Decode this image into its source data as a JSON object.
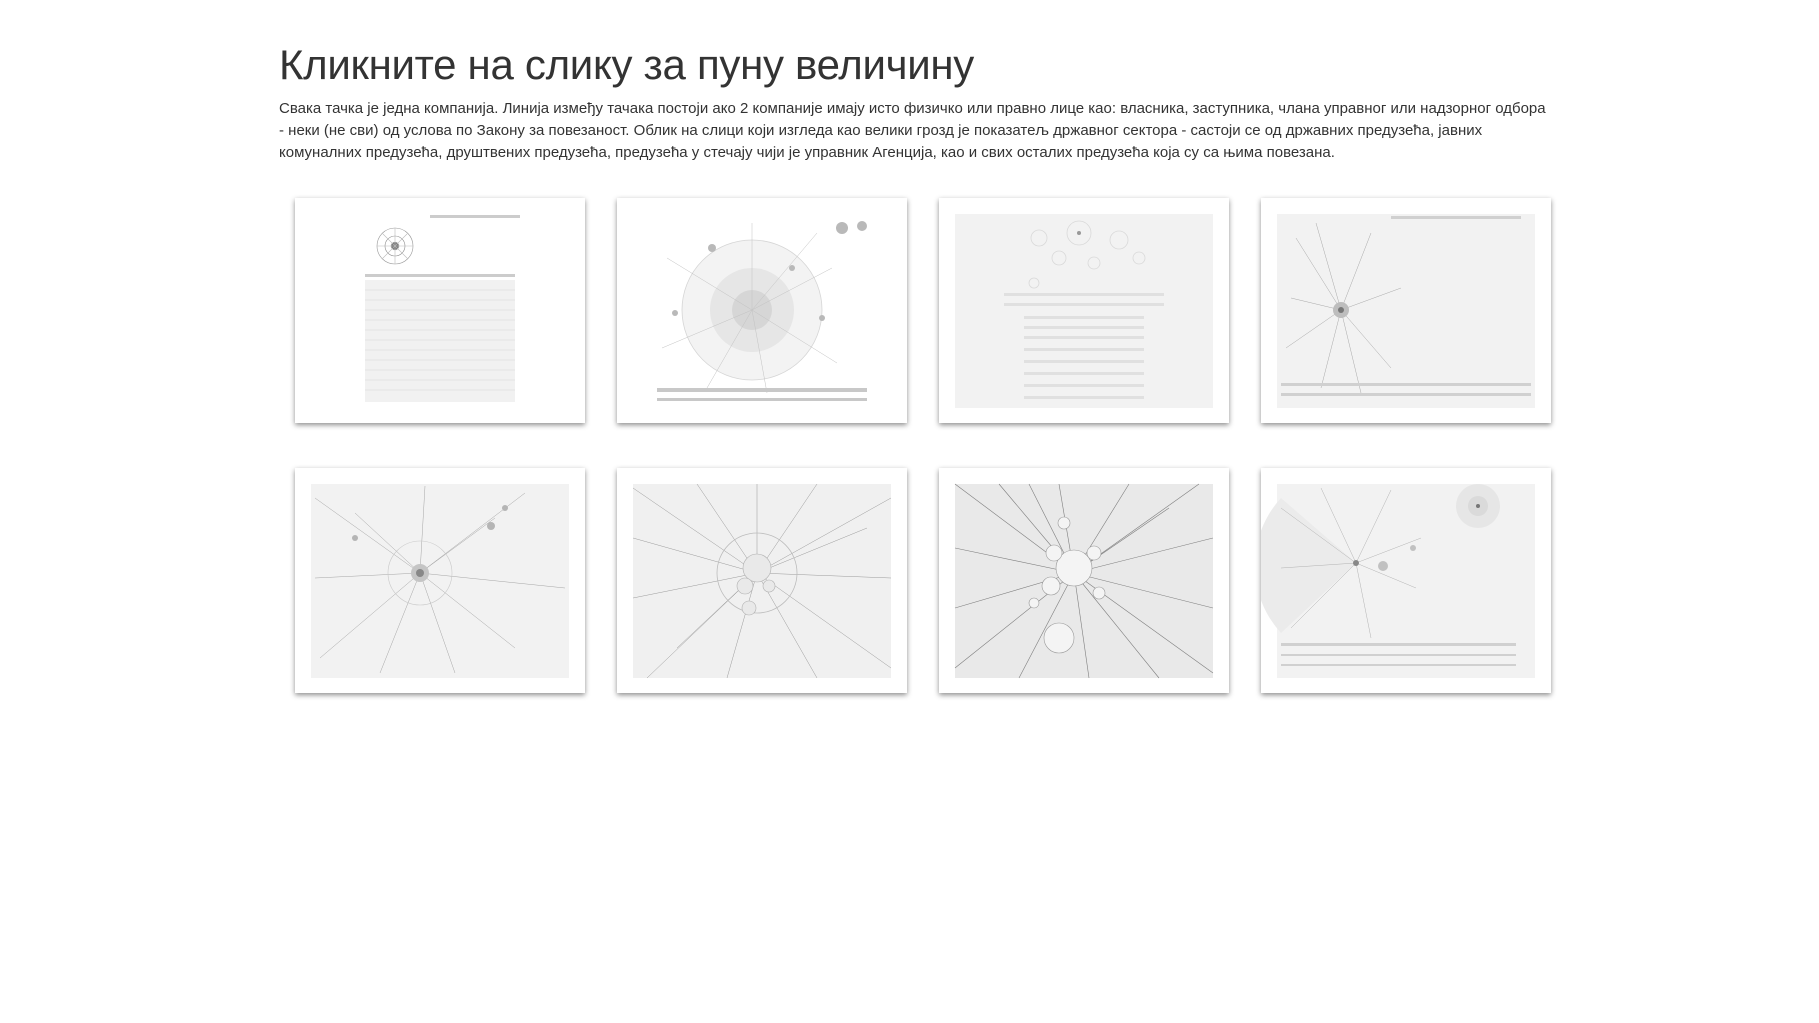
{
  "page": {
    "title": "Кликните на слику за пуну величину",
    "intro": "Свака тачка је једна компанија. Линија између тачака постоји ако 2 компаније имају исто физичко или правно лице као: власника, заступника, члана управног или надзорног одбора - неки (не сви) од услова по Закону за повезаност. Облик на слици који изгледа као велики грозд је показатељ државног сектора - састоји се од државних предузећа, јавних комуналних предузећа, друштвених предузећа, предузећа у стечају чији је управник Агенција, као и свих осталих предузећа која су са њима повезана."
  },
  "gallery": {
    "thumbnails": [
      {
        "icon": "network-graph-thumbnail",
        "style": "cluster-top-with-list"
      },
      {
        "icon": "network-graph-thumbnail",
        "style": "large-dense-cluster"
      },
      {
        "icon": "network-graph-thumbnail",
        "style": "rings-with-list"
      },
      {
        "icon": "network-graph-thumbnail",
        "style": "starburst-left"
      },
      {
        "icon": "network-graph-thumbnail",
        "style": "starburst-center"
      },
      {
        "icon": "network-graph-thumbnail",
        "style": "dense-starburst"
      },
      {
        "icon": "network-graph-thumbnail",
        "style": "very-dense-starburst"
      },
      {
        "icon": "network-graph-thumbnail",
        "style": "sparse-fan"
      }
    ]
  }
}
